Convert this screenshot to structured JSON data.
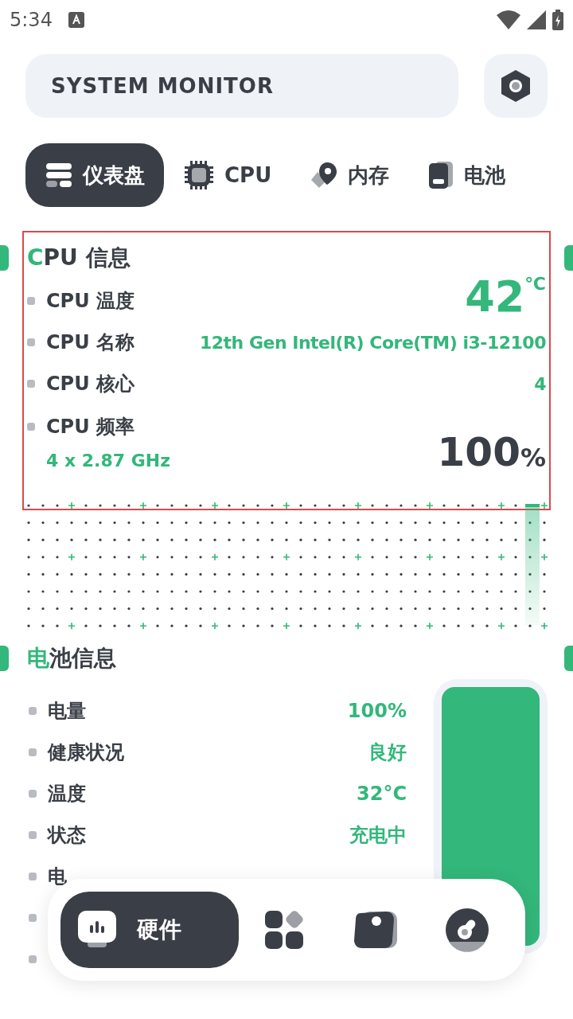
{
  "status_bar": {
    "time": "5:34"
  },
  "header": {
    "title": "SYSTEM MONITOR"
  },
  "tabs": [
    {
      "label": "仪表盘",
      "selected": true
    },
    {
      "label": "CPU",
      "selected": false
    },
    {
      "label": "内存",
      "selected": false
    },
    {
      "label": "电池",
      "selected": false
    }
  ],
  "cpu": {
    "title_accent": "C",
    "title_rest": "PU 信息",
    "highlighted": true,
    "rows": [
      {
        "kind": "temp",
        "label": "CPU 温度",
        "value": "42",
        "unit": "℃"
      },
      {
        "kind": "text",
        "label": "CPU 名称",
        "value": "12th Gen Intel(R) Core(TM) i3-12100"
      },
      {
        "kind": "text",
        "label": "CPU 核心",
        "value": "4"
      },
      {
        "kind": "usage",
        "label": "CPU 频率",
        "sub": "4 x 2.87 GHz",
        "value": "100",
        "unit": "%"
      }
    ]
  },
  "battery": {
    "title_accent": "电",
    "title_rest": "池信息",
    "level": 1,
    "rows": [
      {
        "label": "电量",
        "value": "100%"
      },
      {
        "label": "健康状况",
        "value": "良好"
      },
      {
        "label": "温度",
        "value": "32°C"
      },
      {
        "label": "状态",
        "value": "充电中"
      }
    ],
    "covered_rows": [
      {
        "kind": "text",
        "label": "电"
      },
      {
        "kind": "bullet"
      },
      {
        "kind": "bullet"
      }
    ]
  },
  "bottom_nav": [
    {
      "label": "硬件",
      "selected": true
    },
    {
      "selected": false
    },
    {
      "selected": false
    },
    {
      "selected": false
    }
  ]
}
